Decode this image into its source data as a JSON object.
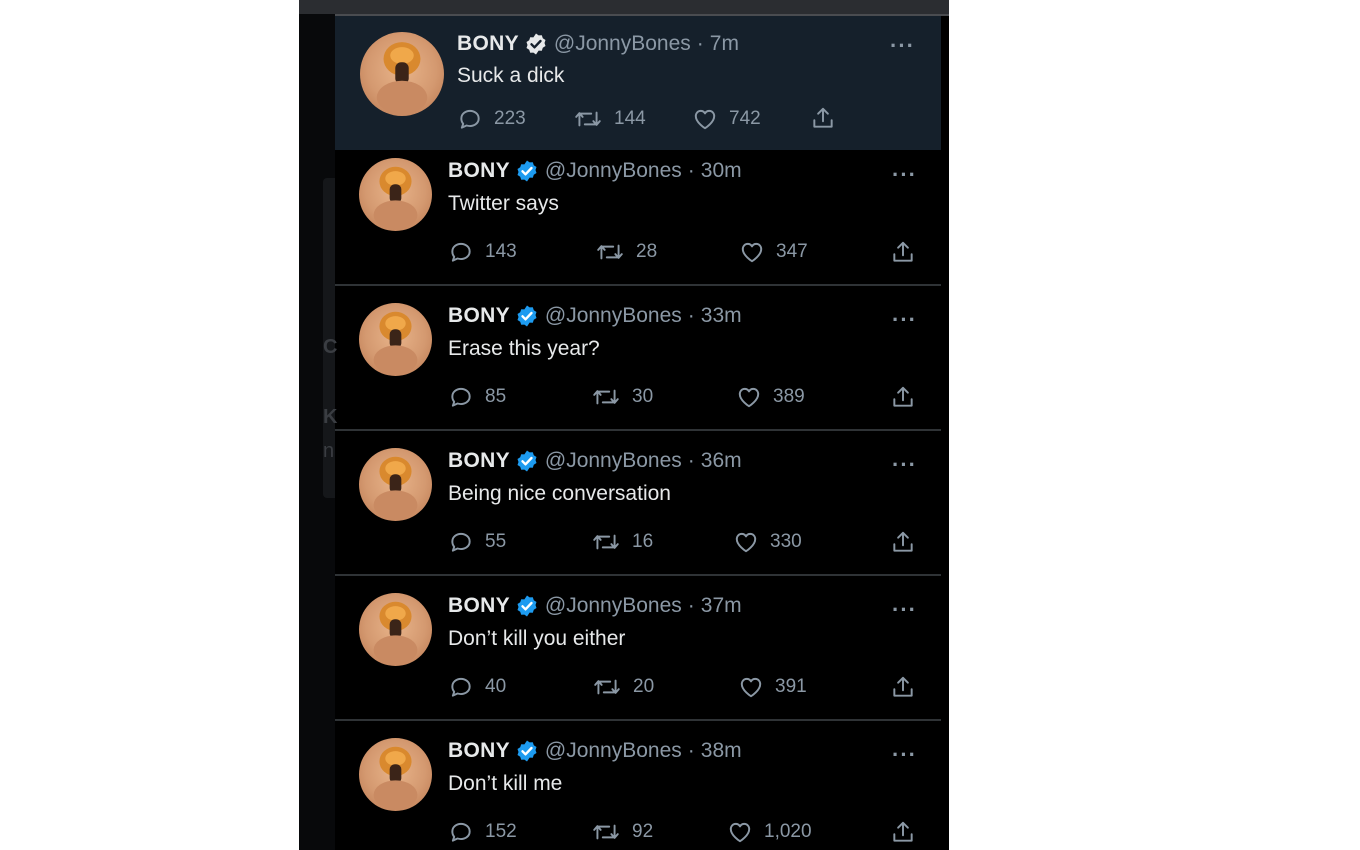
{
  "colors": {
    "background": "#000000",
    "highlight_background": "#15202b",
    "primary_text": "#e7e9ea",
    "secondary_text": "#8b98a5",
    "verified_blue": "#1d9bf0",
    "divider": "#2f3336"
  },
  "icons": {
    "reply": "speech-bubble-icon",
    "retweet": "retweet-arrows-icon",
    "like": "heart-icon",
    "share": "upload-arrow-icon",
    "more": "ellipsis-icon",
    "verified": "verified-badge-icon"
  },
  "ghost": {
    "letter_c": "C",
    "letter_k": "K",
    "letter_n": "n"
  },
  "tweets": [
    {
      "name": "BONY",
      "handle": "@JonnyBones",
      "dot": "·",
      "time": "7m",
      "more": "···",
      "text": "Suck a dick",
      "replies": "223",
      "retweets": "144",
      "likes": "742"
    },
    {
      "name": "BONY",
      "handle": "@JonnyBones",
      "dot": "·",
      "time": "30m",
      "more": "···",
      "text": "Twitter says",
      "replies": "143",
      "retweets": "28",
      "likes": "347"
    },
    {
      "name": "BONY",
      "handle": "@JonnyBones",
      "dot": "·",
      "time": "33m",
      "more": "···",
      "text": "Erase this year?",
      "replies": "85",
      "retweets": "30",
      "likes": "389"
    },
    {
      "name": "BONY",
      "handle": "@JonnyBones",
      "dot": "·",
      "time": "36m",
      "more": "···",
      "text": "Being nice conversation",
      "replies": "55",
      "retweets": "16",
      "likes": "330"
    },
    {
      "name": "BONY",
      "handle": "@JonnyBones",
      "dot": "·",
      "time": "37m",
      "more": "···",
      "text": "Don’t kill you either",
      "replies": "40",
      "retweets": "20",
      "likes": "391"
    },
    {
      "name": "BONY",
      "handle": "@JonnyBones",
      "dot": "·",
      "time": "38m",
      "more": "···",
      "text": "Don’t kill me",
      "replies": "152",
      "retweets": "92",
      "likes": "1,020"
    }
  ]
}
